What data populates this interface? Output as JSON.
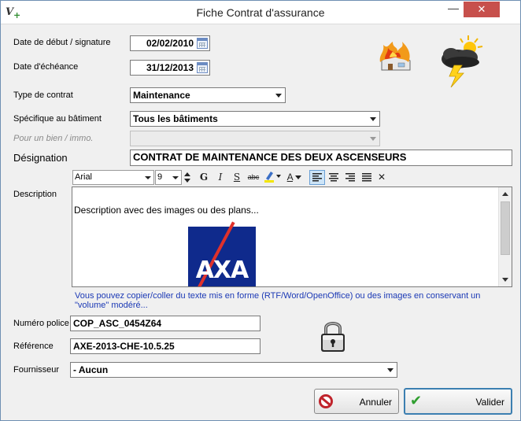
{
  "window": {
    "title": "Fiche Contrat d'assurance",
    "minimize_glyph": "—",
    "close_glyph": "✕",
    "app_icon_glyph": "V",
    "app_icon_plus": "+"
  },
  "form": {
    "start_date": {
      "label": "Date de début / signature",
      "value": "02/02/2010"
    },
    "due_date": {
      "label": "Date d'échéance",
      "value": "31/12/2013"
    },
    "contract_type": {
      "label": "Type de contrat",
      "value": "Maintenance"
    },
    "building": {
      "label": "Spécifique au bâtiment",
      "value": "Tous les bâtiments"
    },
    "property": {
      "label": "Pour un bien / immo.",
      "value": ""
    },
    "designation": {
      "label": "Désignation",
      "value": "CONTRAT DE MAINTENANCE DES DEUX ASCENSEURS"
    },
    "description": {
      "label": "Description",
      "text": "Description avec des images ou des plans...",
      "logo_text": "AXA",
      "hint": "Vous pouvez copier/coller du texte mis en forme (RTF/Word/OpenOffice) ou des images en conservant un \"volume\" modéré..."
    },
    "policy_number": {
      "label": "Numéro police",
      "value": "COP_ASC_0454Z64"
    },
    "reference": {
      "label": "Référence",
      "value": "AXE-2013-CHE-10.5.25"
    },
    "supplier": {
      "label": "Fournisseur",
      "value": "- Aucun"
    }
  },
  "toolbar": {
    "font": "Arial",
    "size": "9",
    "bold": "G",
    "italic": "I",
    "underline": "S",
    "strike": "abc",
    "text_color": "A",
    "close": "✕"
  },
  "buttons": {
    "cancel": "Annuler",
    "validate": "Valider"
  },
  "colors": {
    "accent": "#3c7fb1",
    "hint_text": "#1b39b5",
    "close_button": "#c7504c",
    "axa_blue": "#0f2a8c",
    "axa_red": "#e0312b"
  }
}
